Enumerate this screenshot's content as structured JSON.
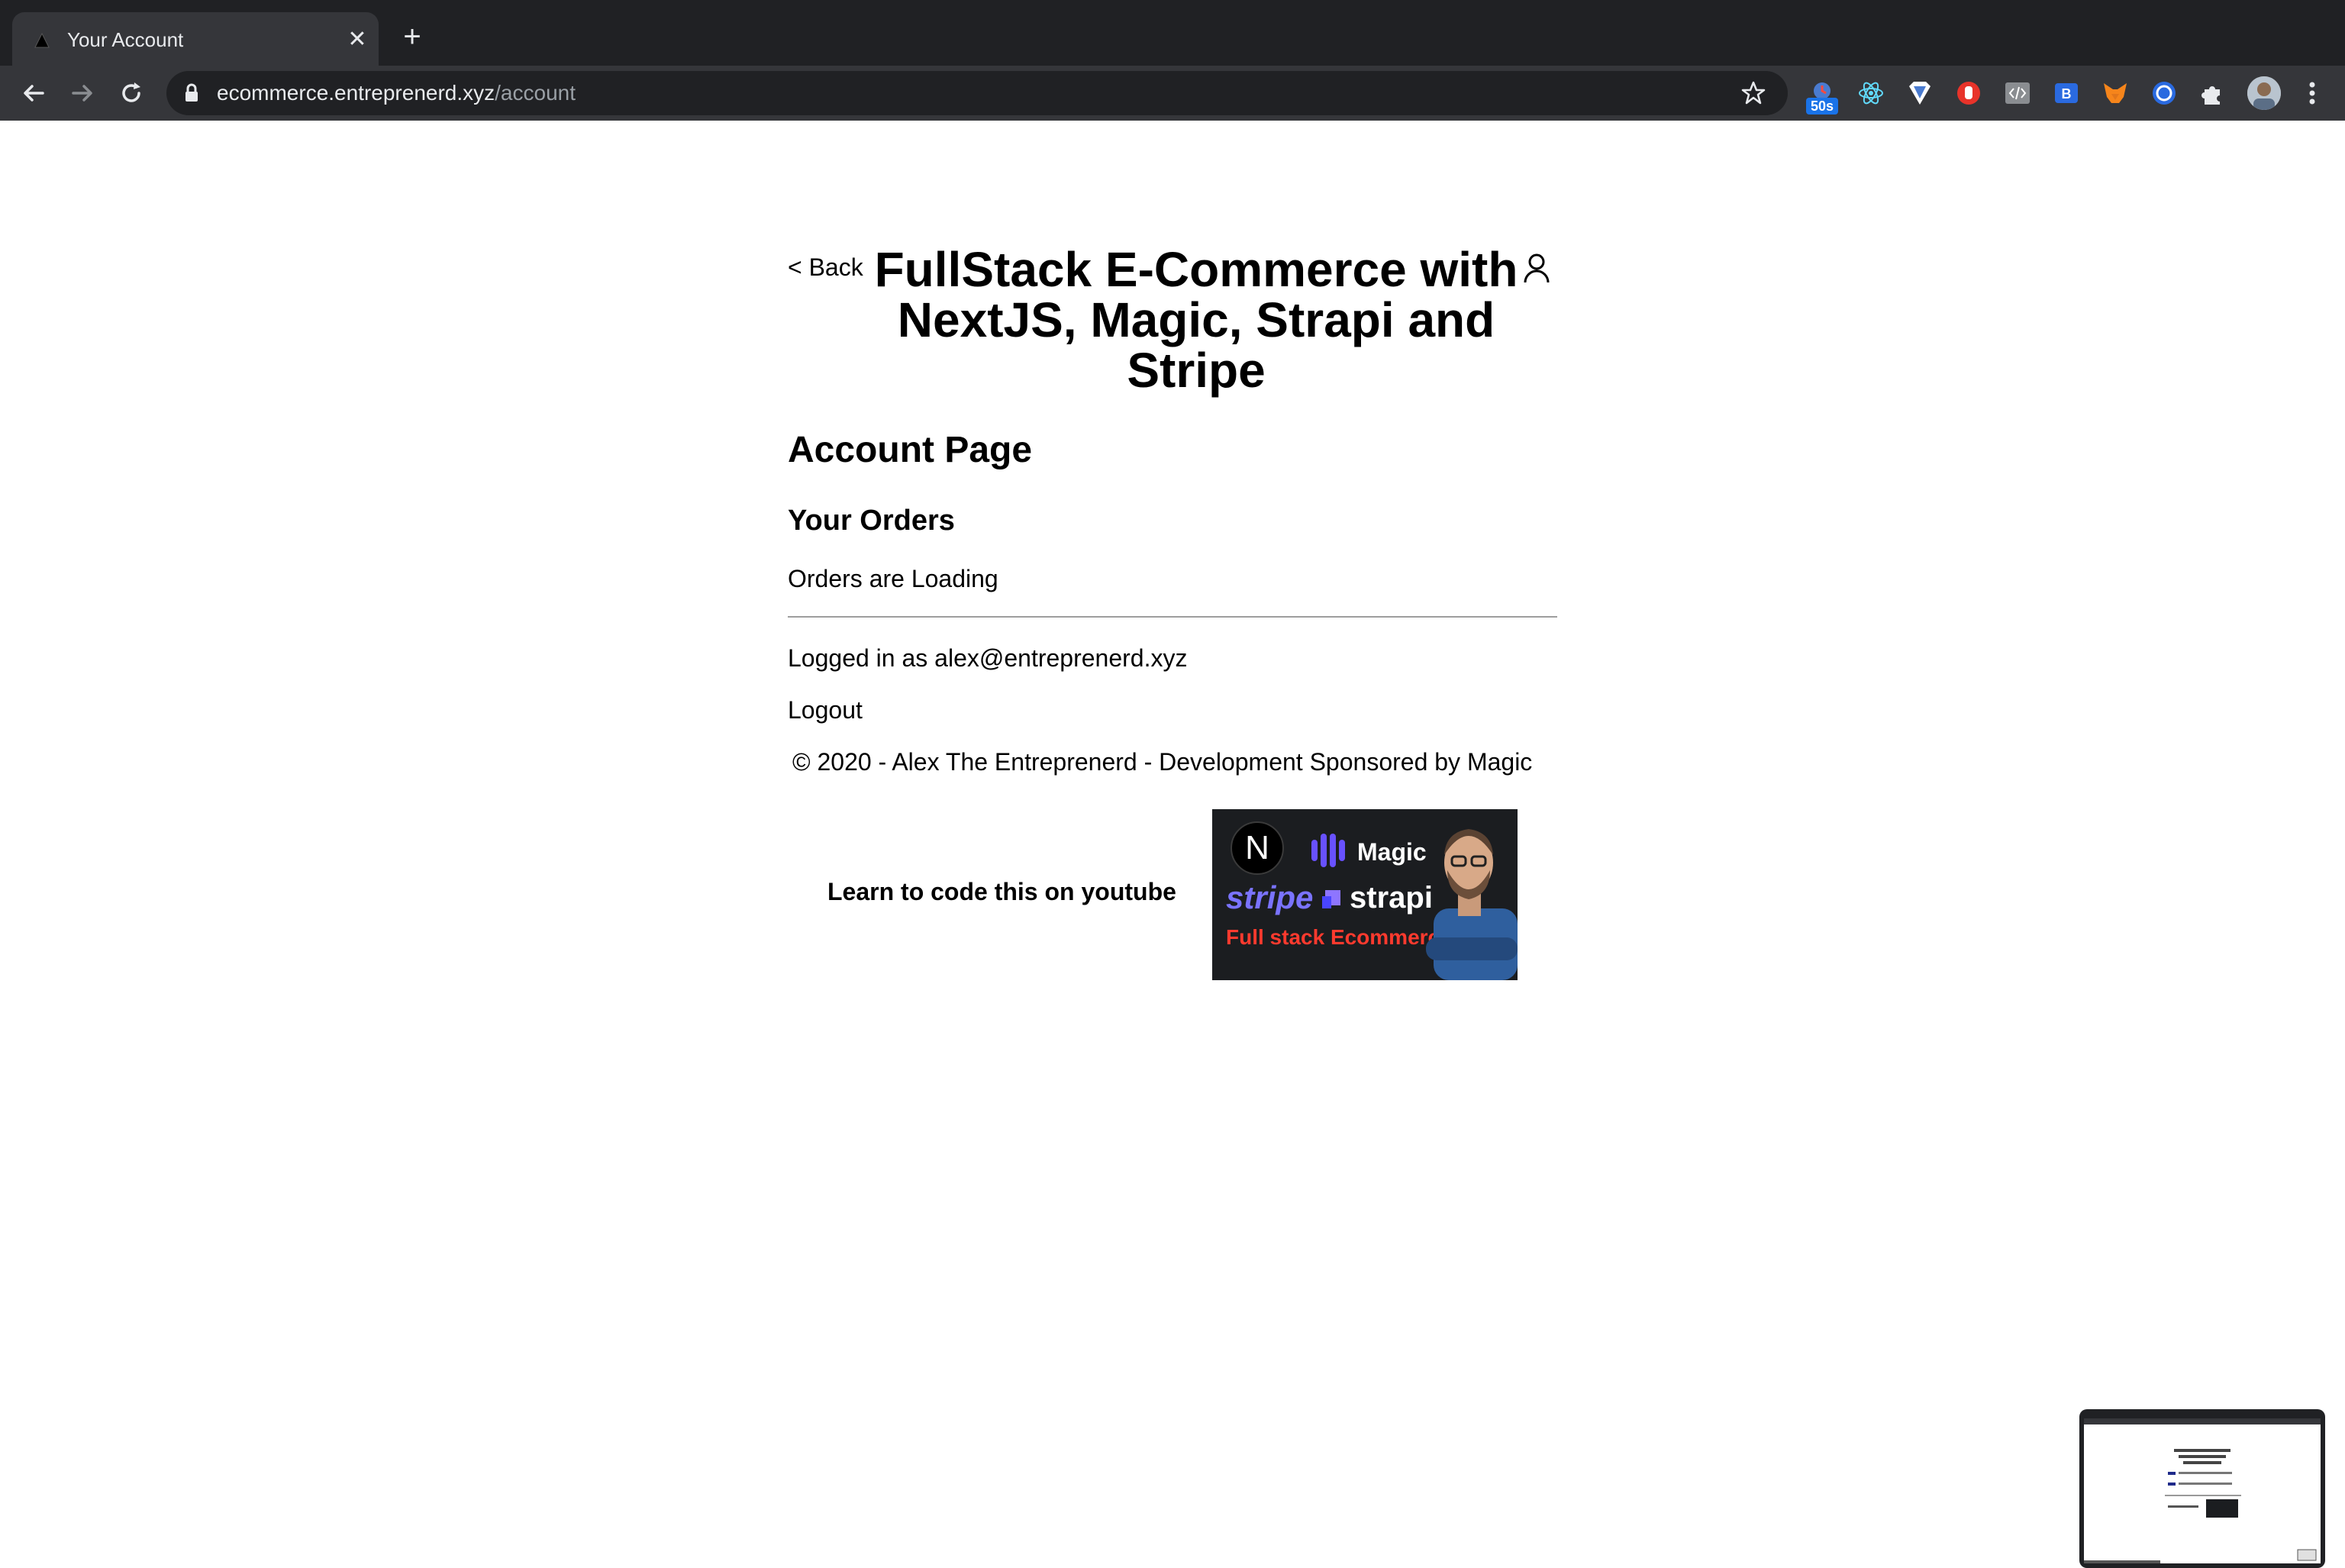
{
  "browser": {
    "tab_title": "Your Account",
    "url_host": "ecommerce.entreprenerd.xyz",
    "url_path": "/account",
    "extension_badge": "50s"
  },
  "page": {
    "back_label": "< Back",
    "site_title": "FullStack E-Commerce with NextJS, Magic, Strapi and Stripe",
    "account_heading": "Account Page",
    "orders_heading": "Your Orders",
    "orders_status": "Orders are Loading",
    "logged_in_text": "Logged in as alex@entreprenerd.xyz",
    "logout_label": "Logout",
    "footer_text": "© 2020 - Alex The Entreprenerd - Development Sponsored by Magic",
    "learn_text": "Learn to code this on youtube",
    "thumbnail": {
      "n_logo": "N",
      "magic": "Magic",
      "stripe": "stripe",
      "strapi": "strapi",
      "caption": "Full stack Ecommerce"
    }
  },
  "colors": {
    "chrome_dark": "#202124",
    "chrome_toolbar": "#35363a",
    "page_background": "#ffffff",
    "divider": "#9e9e9e",
    "stripe_purple": "#7a73ff",
    "caption_red": "#ff3a2e"
  },
  "icons": [
    "back-arrow-icon",
    "forward-arrow-icon",
    "reload-icon",
    "lock-icon",
    "star-icon",
    "user-icon",
    "puzzle-icon",
    "menu-dots-icon",
    "close-icon",
    "plus-icon"
  ]
}
